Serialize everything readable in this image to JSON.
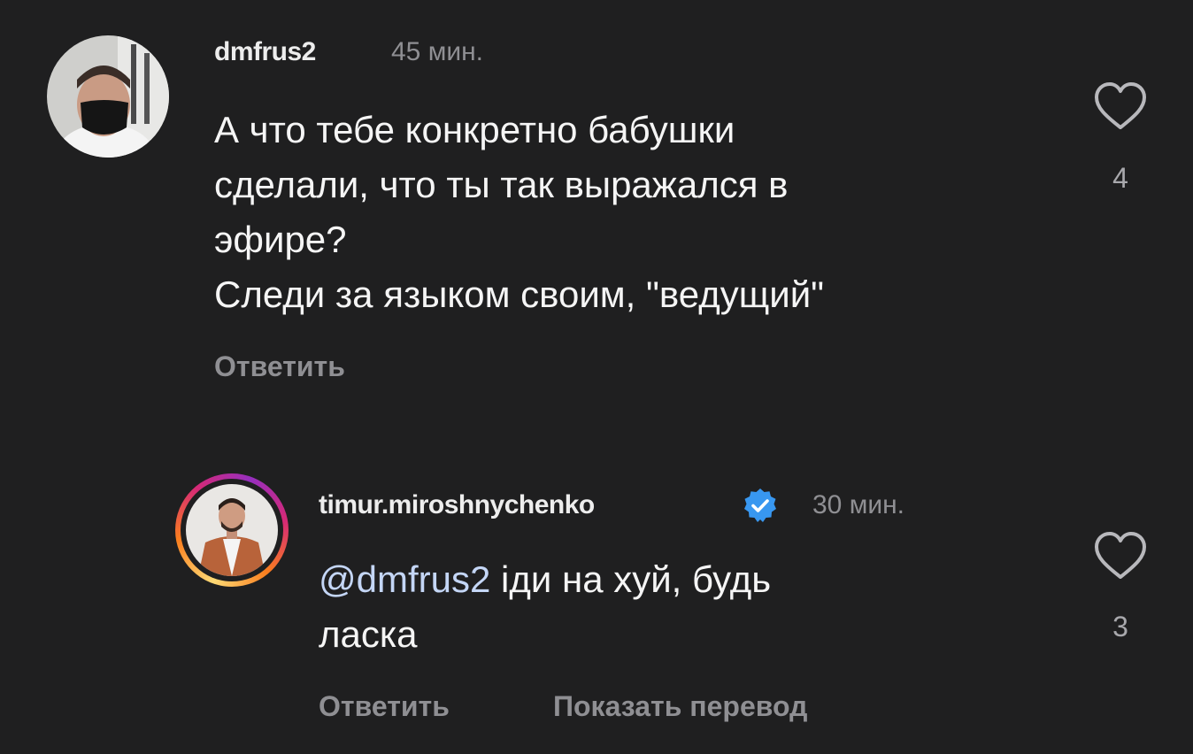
{
  "comments": [
    {
      "username": "dmfrus2",
      "time": "45 мин.",
      "lines": [
        "А что тебе конкретно бабушки",
        "сделали, что ты так выражался в",
        "эфире?",
        "Следи за языком своим, \"ведущий\""
      ],
      "reply_label": "Ответить",
      "likes": "4",
      "avatar_icon": "avatar-masked-man"
    },
    {
      "username": "timur.miroshnychenko",
      "verified": true,
      "time": "30 мин.",
      "mention": "@dmfrus2",
      "line1_rest": " іди на хуй, будь",
      "line2": "ласка",
      "reply_label": "Ответить",
      "translate_label": "Показать перевод",
      "likes": "3",
      "avatar_icon": "avatar-man-in-suit"
    }
  ],
  "colors": {
    "background": "#1f1f20",
    "text": "#f5f5f5",
    "muted": "#8f8f93",
    "mention": "#c4d6f6",
    "verified": "#3897f0"
  }
}
